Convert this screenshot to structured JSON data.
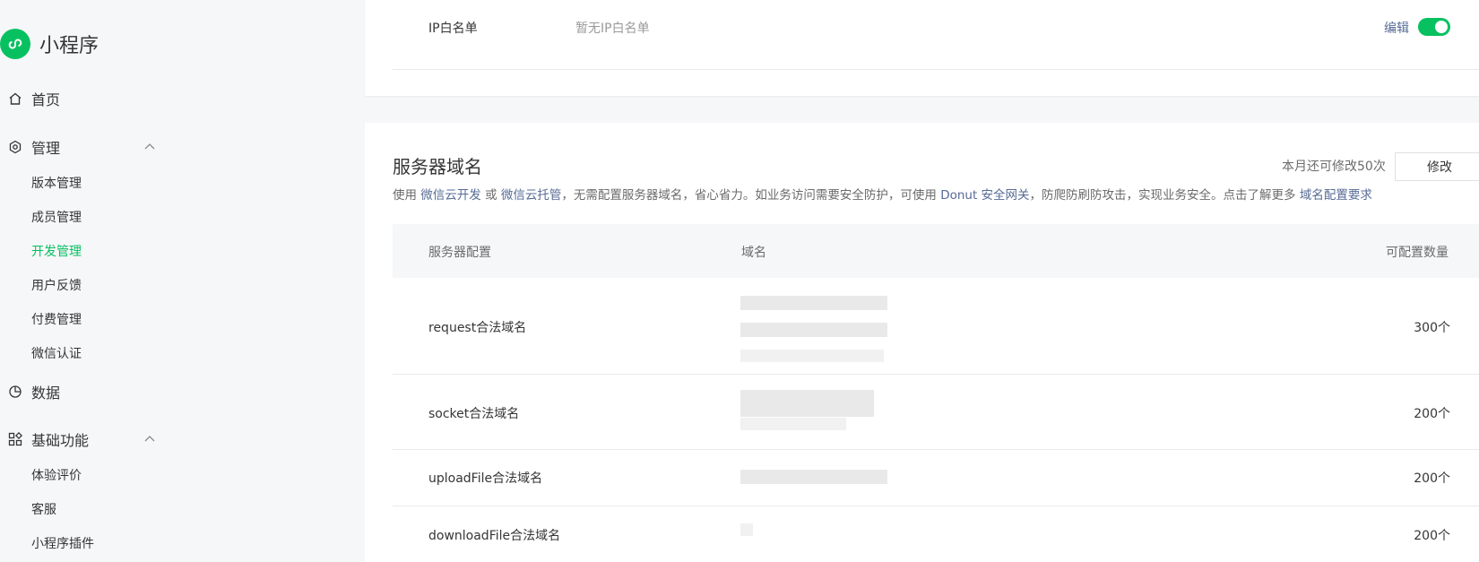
{
  "sidebar": {
    "brand": "小程序",
    "items": [
      {
        "label": "首页"
      },
      {
        "label": "管理"
      },
      {
        "label": "版本管理"
      },
      {
        "label": "成员管理"
      },
      {
        "label": "开发管理"
      },
      {
        "label": "用户反馈"
      },
      {
        "label": "付费管理"
      },
      {
        "label": "微信认证"
      },
      {
        "label": "数据"
      },
      {
        "label": "基础功能"
      },
      {
        "label": "体验评价"
      },
      {
        "label": "客服"
      },
      {
        "label": "小程序插件"
      }
    ],
    "active_item": "开发管理"
  },
  "ip_whitelist": {
    "label": "IP白名单",
    "value": "暂无IP白名单",
    "edit_label": "编辑",
    "toggle_on": true
  },
  "server_domains": {
    "title": "服务器域名",
    "quota_text": "本月还可修改50次",
    "modify_label": "修改",
    "desc": {
      "part1": "使用",
      "link1": "微信云开发",
      "part2": "或",
      "link2": "微信云托管",
      "part3": "，无需配置服务器域名，省心省力。如业务访问需要安全防护，可使用",
      "link3": "Donut 安全网关",
      "part4": "，防爬防刷防攻击，实现业务安全。点击了解更多",
      "link4": "域名配置要求"
    },
    "table": {
      "headers": [
        "服务器配置",
        "域名",
        "可配置数量"
      ],
      "rows": [
        {
          "name": "request合法域名",
          "count": "300个"
        },
        {
          "name": "socket合法域名",
          "count": "200个"
        },
        {
          "name": "uploadFile合法域名",
          "count": "200个"
        },
        {
          "name": "downloadFile合法域名",
          "count": "200个"
        }
      ]
    }
  },
  "colors": {
    "accent": "#07c160",
    "link": "#576b95"
  }
}
